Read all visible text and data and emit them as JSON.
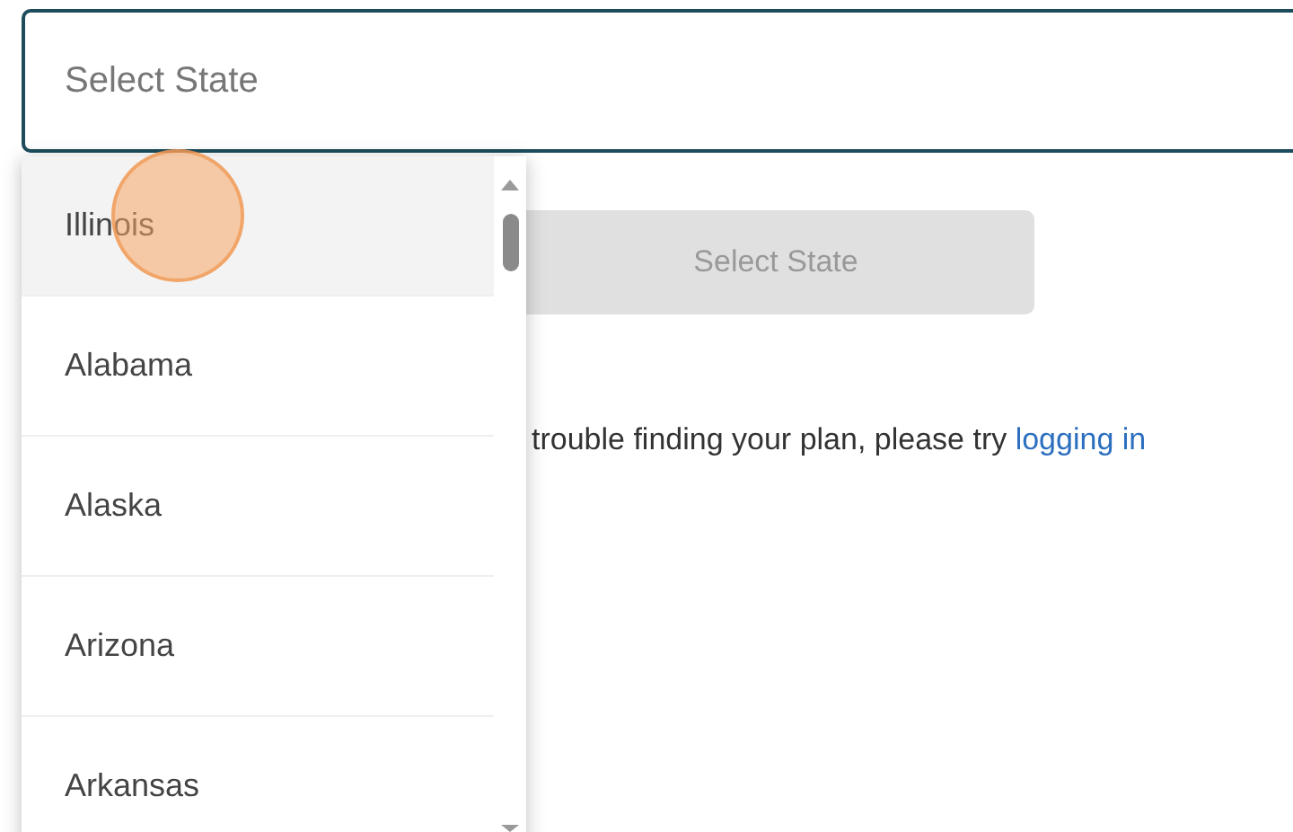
{
  "state_field": {
    "placeholder": "Select State"
  },
  "dropdown": {
    "options": [
      {
        "label": "Illinois",
        "selected": true
      },
      {
        "label": "Alabama",
        "selected": false
      },
      {
        "label": "Alaska",
        "selected": false
      },
      {
        "label": "Arizona",
        "selected": false
      },
      {
        "label": "Arkansas",
        "selected": false
      }
    ]
  },
  "submit_button": {
    "label": "Select State",
    "disabled": true
  },
  "help_text": {
    "text": "trouble finding your plan, please try",
    "link": "logging in"
  }
}
